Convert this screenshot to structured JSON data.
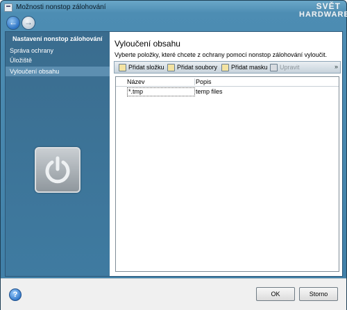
{
  "window": {
    "title": "Možnosti nonstop zálohování"
  },
  "brand": {
    "line1": "SVĚT",
    "line2": "HARDWARE"
  },
  "nav": {
    "back_icon": "arrow-left-icon",
    "forward_icon": "arrow-right-icon"
  },
  "sidebar": {
    "header": "Nastavení nonstop zálohování",
    "items": [
      {
        "label": "Správa ochrany",
        "active": false
      },
      {
        "label": "Úložiště",
        "active": false
      },
      {
        "label": "Vyloučení obsahu",
        "active": true
      }
    ],
    "tile_icon": "power-icon"
  },
  "content": {
    "title": "Vyloučení obsahu",
    "description": "Vyberte položky, které chcete z ochrany pomocí nonstop zálohování vyloučit.",
    "toolbar": {
      "add_folder": "Přidat složku",
      "add_files": "Přidat soubory",
      "add_mask": "Přidat masku",
      "edit": "Upravit",
      "more": "»"
    },
    "list": {
      "columns": [
        "Název",
        "Popis"
      ],
      "rows": [
        {
          "name": "*.tmp",
          "description": "temp files"
        }
      ]
    }
  },
  "footer": {
    "help": "?",
    "ok": "OK",
    "cancel": "Storno"
  }
}
